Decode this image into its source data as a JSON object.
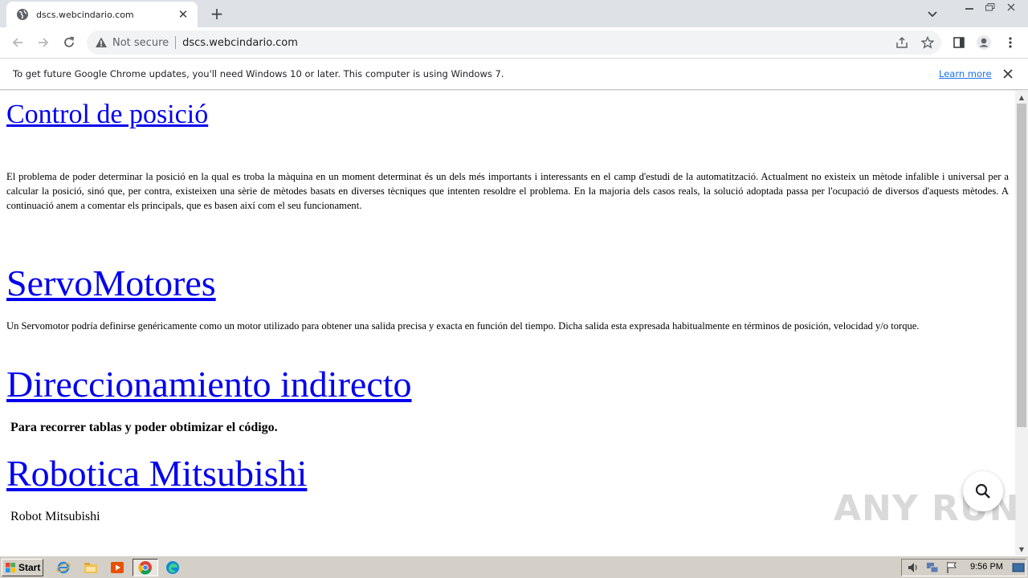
{
  "browser": {
    "tab_title": "dscs.webcindario.com",
    "not_secure_label": "Not secure",
    "url": "dscs.webcindario.com"
  },
  "infobar": {
    "message": "To get future Google Chrome updates, you'll need Windows 10 or later. This computer is using Windows 7.",
    "learn_more": "Learn more"
  },
  "content": {
    "sections": [
      {
        "heading": "Control de posició",
        "text": "El problema de poder determinar la posició en la qual es troba la màquina en un moment determinat és un dels més importants i interessants en el camp d'estudi de la automatització. Actualment no existeix un mètode infalible i universal per a calcular la posició, sinó que, per contra, existeixen una sèrie de mètodes basats en diverses tècniques que intenten resoldre el problema. En la majoria dels casos reals, la solució adoptada passa per l'ocupació de diversos d'aquests mètodes. A continuació anem a comentar els principals, que es basen així com el seu funcionament."
      },
      {
        "heading": "ServoMotores",
        "text": "Un Servomotor podría definirse genéricamente como un motor utilizado para obtener una salida precisa y exacta en función del tiempo. Dicha salida esta expresada habitualmente en términos de posición, velocidad y/o torque."
      },
      {
        "heading": "Direccionamiento indirecto",
        "text": "Para recorrer tablas y poder obtimizar el código."
      },
      {
        "heading": "Robotica Mitsubishi",
        "text": "Robot Mitsubishi"
      }
    ]
  },
  "watermark": "ANY RUN",
  "taskbar": {
    "start_label": "Start",
    "clock": "9:56 PM"
  },
  "colors": {
    "link": "#0000ee",
    "chrome_frame": "#dee1e6",
    "taskbar": "#d4d0c8"
  }
}
